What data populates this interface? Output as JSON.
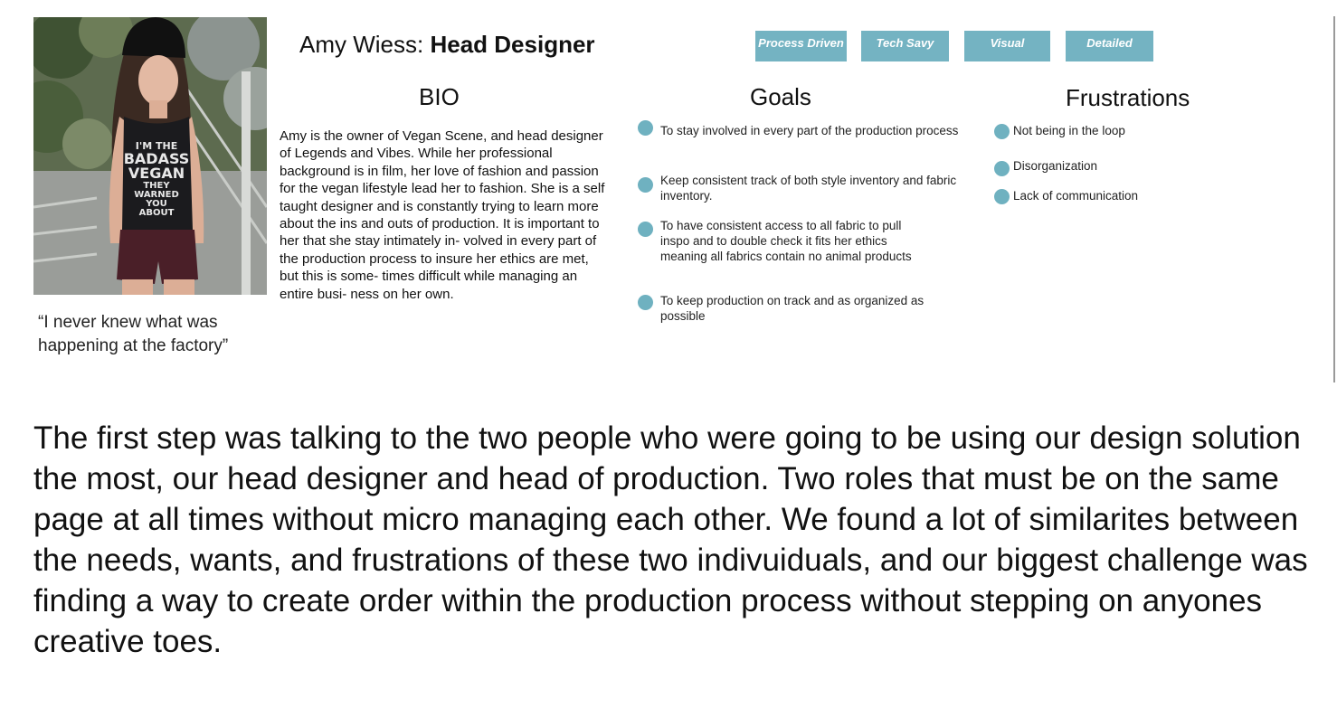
{
  "persona": {
    "name": "Amy Wiess:",
    "role": "Head Designer",
    "quote": "“I never knew what was happening at the factory”",
    "photo": {
      "shirt_text": [
        "I'M THE",
        "BADASS",
        "VEGAN",
        "THEY",
        "WARNED",
        "YOU",
        "ABOUT"
      ]
    },
    "tags": [
      "Process Driven",
      "Tech Savy",
      "Visual",
      "Detailed"
    ],
    "tag_color": "#74b3c2",
    "bullet_color": "#6fb1c0"
  },
  "bio": {
    "heading": "BIO",
    "text": "Amy is the owner of Vegan Scene, and head designer of Legends and Vibes. While her professional background is in film, her love of fashion and passion for the vegan lifestyle lead her to fashion. She is a self taught designer and is constantly trying to learn more about the ins and outs of production. It is important to her that she stay intimately in- volved in every part of the production process to insure her ethics are met, but this is some- times difficult while managing an entire busi- ness on her own."
  },
  "goals": {
    "heading": "Goals",
    "items": [
      "To stay involved in every part of the production process",
      "Keep consistent track of both style inventory and fabric inventory.",
      "To have consistent access to all fabric to pull inspo and to double check it fits her ethics meaning all fabrics contain no animal products",
      "To keep production on track and as organized as possible"
    ]
  },
  "frustrations": {
    "heading": "Frustrations",
    "items": [
      "Not being in the loop",
      "Disorganization",
      "Lack of communication"
    ]
  },
  "paragraph": "The first step was talking to the two people who were going to be using our design solution the most, our head designer and head of production. Two roles that must be on the same page at all times without micro managing each other. We found a lot of similarites between the needs, wants, and frustrations of these two indivuiduals, and our biggest challenge was finding a way to create order within the production process without stepping on anyones creative toes."
}
